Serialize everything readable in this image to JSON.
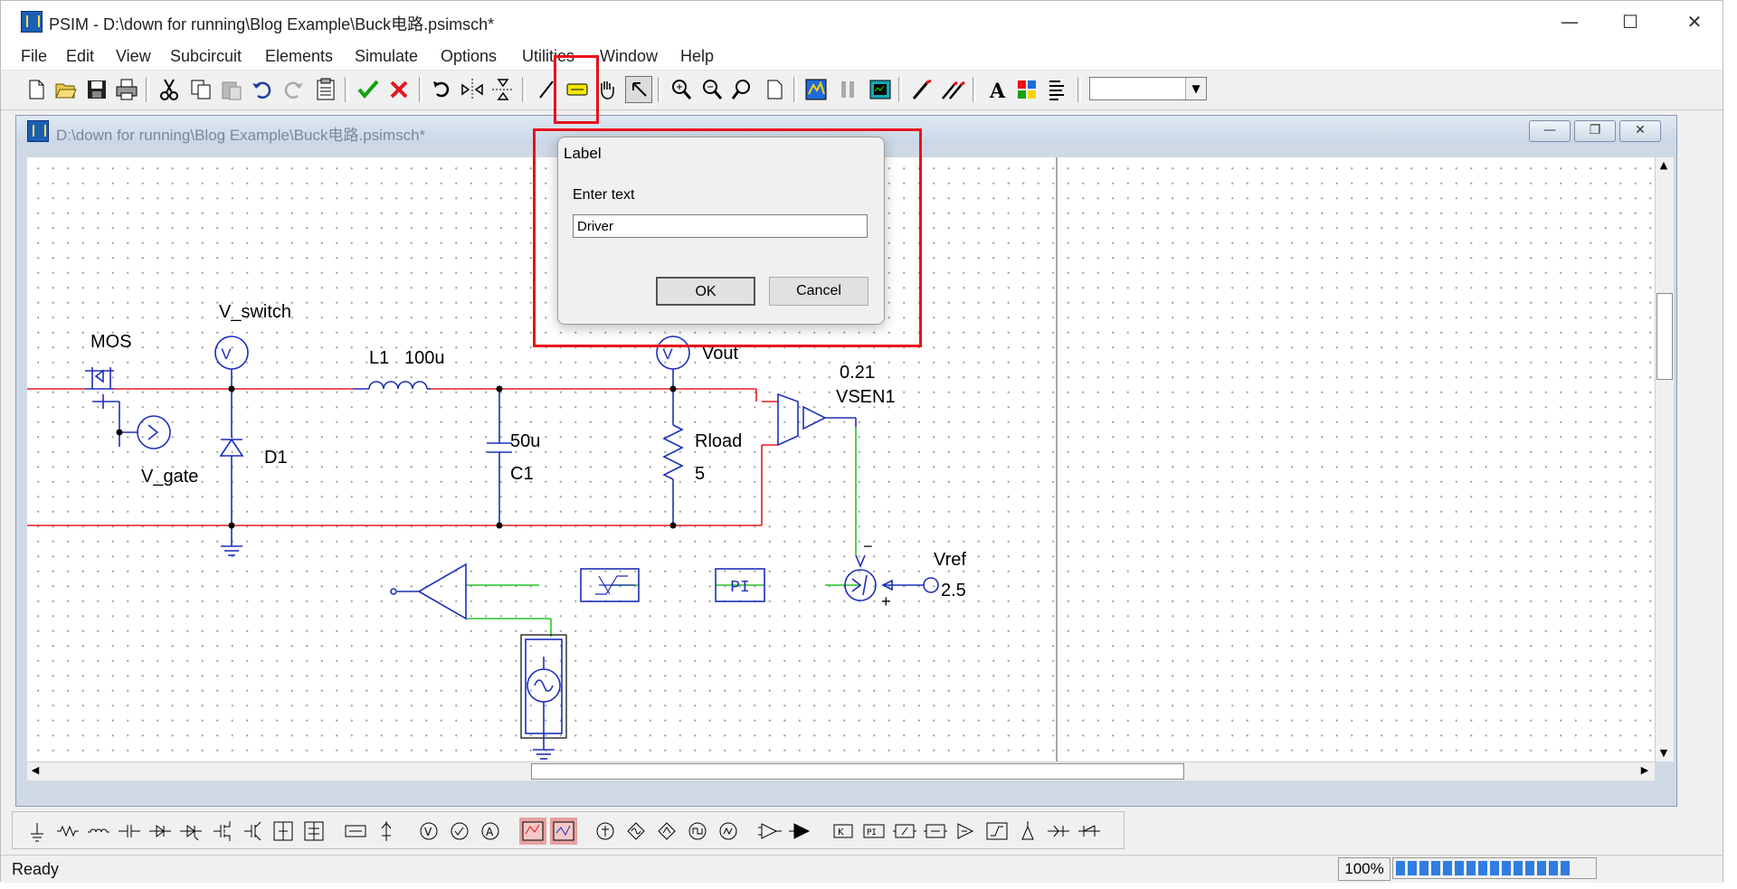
{
  "window": {
    "title": "PSIM - D:\\down for running\\Blog Example\\Buck电路.psimsch*",
    "controls": [
      "minimize-icon",
      "maximize-icon",
      "close-icon"
    ]
  },
  "menu": [
    "File",
    "Edit",
    "View",
    "Subcircuit",
    "Elements",
    "Simulate",
    "Options",
    "Utilities",
    "Window",
    "Help"
  ],
  "toolbar": {
    "combo_value": "",
    "icons": [
      "new-icon",
      "open-icon",
      "save-icon",
      "print-icon",
      "cut-icon",
      "copy-icon",
      "paste-icon",
      "undo-icon",
      "redo-icon",
      "clipboard-icon",
      "check-icon",
      "cross-icon",
      "rotate-icon",
      "flip-lr-icon",
      "flip-tb-icon",
      "wire-icon",
      "label-icon",
      "pan-icon",
      "select-icon",
      "zoom-in-icon",
      "zoom-out-icon",
      "zoom-fit-icon",
      "page-icon",
      "run-simulation-icon",
      "pause-icon",
      "simview-icon",
      "probe-icon",
      "multi-probe-icon",
      "text-icon",
      "element-list-icon",
      "netlist-icon"
    ]
  },
  "child_window": {
    "title": "D:\\down for running\\Blog Example\\Buck电路.psimsch*"
  },
  "schematic": {
    "labels": {
      "mos": "MOS",
      "v_switch": "V_switch",
      "v_gate": "V_gate",
      "l1": "L1",
      "l1_value": "100u",
      "d1": "D1",
      "c_value": "50u",
      "c1": "C1",
      "vout": "Vout",
      "rload": "Rload",
      "rload_value": "5",
      "vsen_gain": "0.21",
      "vsen1": "VSEN1",
      "vref": "Vref",
      "vref_value": "2.5",
      "pi": "PI",
      "meter_v": "V",
      "minus": "−",
      "plus": "+"
    },
    "colors": {
      "power_wire": "#e81b23",
      "control_wire": "#26c426",
      "component": "#1d2fb8"
    }
  },
  "dialog": {
    "title": "Label",
    "prompt": "Enter text",
    "value": "Driver",
    "ok": "OK",
    "cancel": "Cancel"
  },
  "highlight_color": "#e8101e",
  "status": {
    "text": "Ready",
    "zoom": "100%",
    "progress": 0.96
  }
}
